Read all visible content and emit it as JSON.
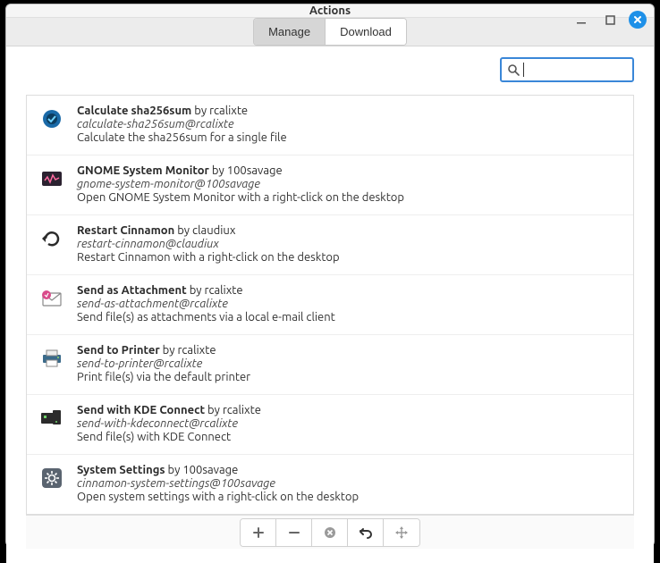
{
  "window": {
    "title": "Actions"
  },
  "tabs": {
    "manage": "Manage",
    "download": "Download",
    "active": "manage"
  },
  "search": {
    "placeholder": "",
    "value": ""
  },
  "items": [
    {
      "name": "Calculate sha256sum",
      "by_prefix": "by",
      "author": "rcalixte",
      "id": "calculate-sha256sum@rcalixte",
      "desc": "Calculate the sha256sum for a single file",
      "icon": "calc-icon"
    },
    {
      "name": "GNOME System Monitor",
      "by_prefix": "by",
      "author": "100savage",
      "id": "gnome-system-monitor@100savage",
      "desc": "Open GNOME System Monitor with a right-click on the desktop",
      "icon": "monitor-icon"
    },
    {
      "name": "Restart Cinnamon",
      "by_prefix": "by",
      "author": "claudiux",
      "id": "restart-cinnamon@claudiux",
      "desc": "Restart Cinnamon with a right-click on the desktop",
      "icon": "restart-icon"
    },
    {
      "name": "Send as Attachment",
      "by_prefix": "by",
      "author": "rcalixte",
      "id": "send-as-attachment@rcalixte",
      "desc": "Send file(s) as attachments via a local e-mail client",
      "icon": "attachment-icon"
    },
    {
      "name": "Send to Printer",
      "by_prefix": "by",
      "author": "rcalixte",
      "id": "send-to-printer@rcalixte",
      "desc": "Print file(s) via the default printer",
      "icon": "printer-icon"
    },
    {
      "name": "Send with KDE Connect",
      "by_prefix": "by",
      "author": "rcalixte",
      "id": "send-with-kdeconnect@rcalixte",
      "desc": "Send file(s) with KDE Connect",
      "icon": "kdeconnect-icon"
    },
    {
      "name": "System Settings",
      "by_prefix": "by",
      "author": "100savage",
      "id": "cinnamon-system-settings@100savage",
      "desc": "Open system settings with a right-click on the desktop",
      "icon": "settings-icon"
    }
  ],
  "buttons": {
    "add": "add",
    "remove": "remove",
    "disable": "disable",
    "reset": "reset",
    "move": "move"
  }
}
